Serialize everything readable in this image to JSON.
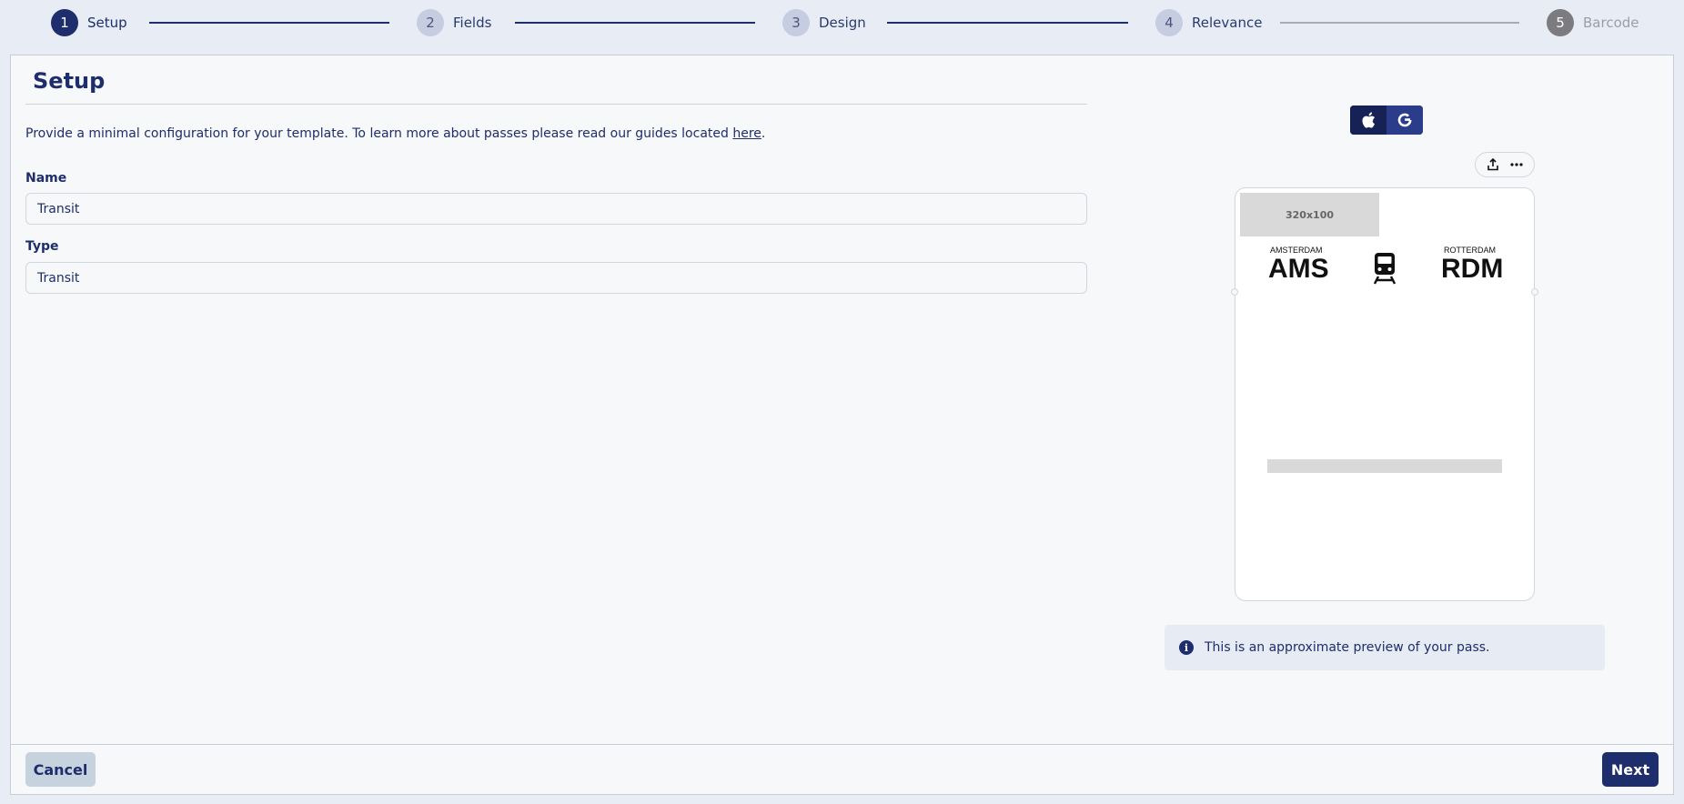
{
  "stepper": {
    "steps": [
      {
        "number": "1",
        "label": "Setup",
        "state": "active"
      },
      {
        "number": "2",
        "label": "Fields",
        "state": "todo"
      },
      {
        "number": "3",
        "label": "Design",
        "state": "todo"
      },
      {
        "number": "4",
        "label": "Relevance",
        "state": "todo"
      },
      {
        "number": "5",
        "label": "Barcode",
        "state": "disabled"
      }
    ]
  },
  "setup": {
    "title": "Setup",
    "intro_text": "Provide a minimal configuration for your template. To learn more about passes please read our guides located ",
    "intro_link": "here",
    "intro_end": ".",
    "name_label": "Name",
    "name_value": "Transit",
    "type_label": "Type",
    "type_value": "Transit"
  },
  "preview": {
    "platforms": [
      {
        "name": "apple",
        "icon": "apple-icon",
        "selected": true
      },
      {
        "name": "google",
        "icon": "google-icon",
        "selected": false
      }
    ],
    "toolbar": {
      "share_icon": "share-icon",
      "more_icon": "more-icon"
    },
    "pass": {
      "logo_placeholder": "320x100",
      "origin_label": "AMSTERDAM",
      "origin_code": "AMS",
      "destination_label": "ROTTERDAM",
      "destination_code": "RDM",
      "transit_icon": "train-icon"
    },
    "info_text": "This is an approximate preview of your pass."
  },
  "footer": {
    "cancel_label": "Cancel",
    "next_label": "Next"
  },
  "colors": {
    "primary": "#1e2d6b",
    "background": "#e8edf5",
    "panel": "#f7f8fa"
  }
}
